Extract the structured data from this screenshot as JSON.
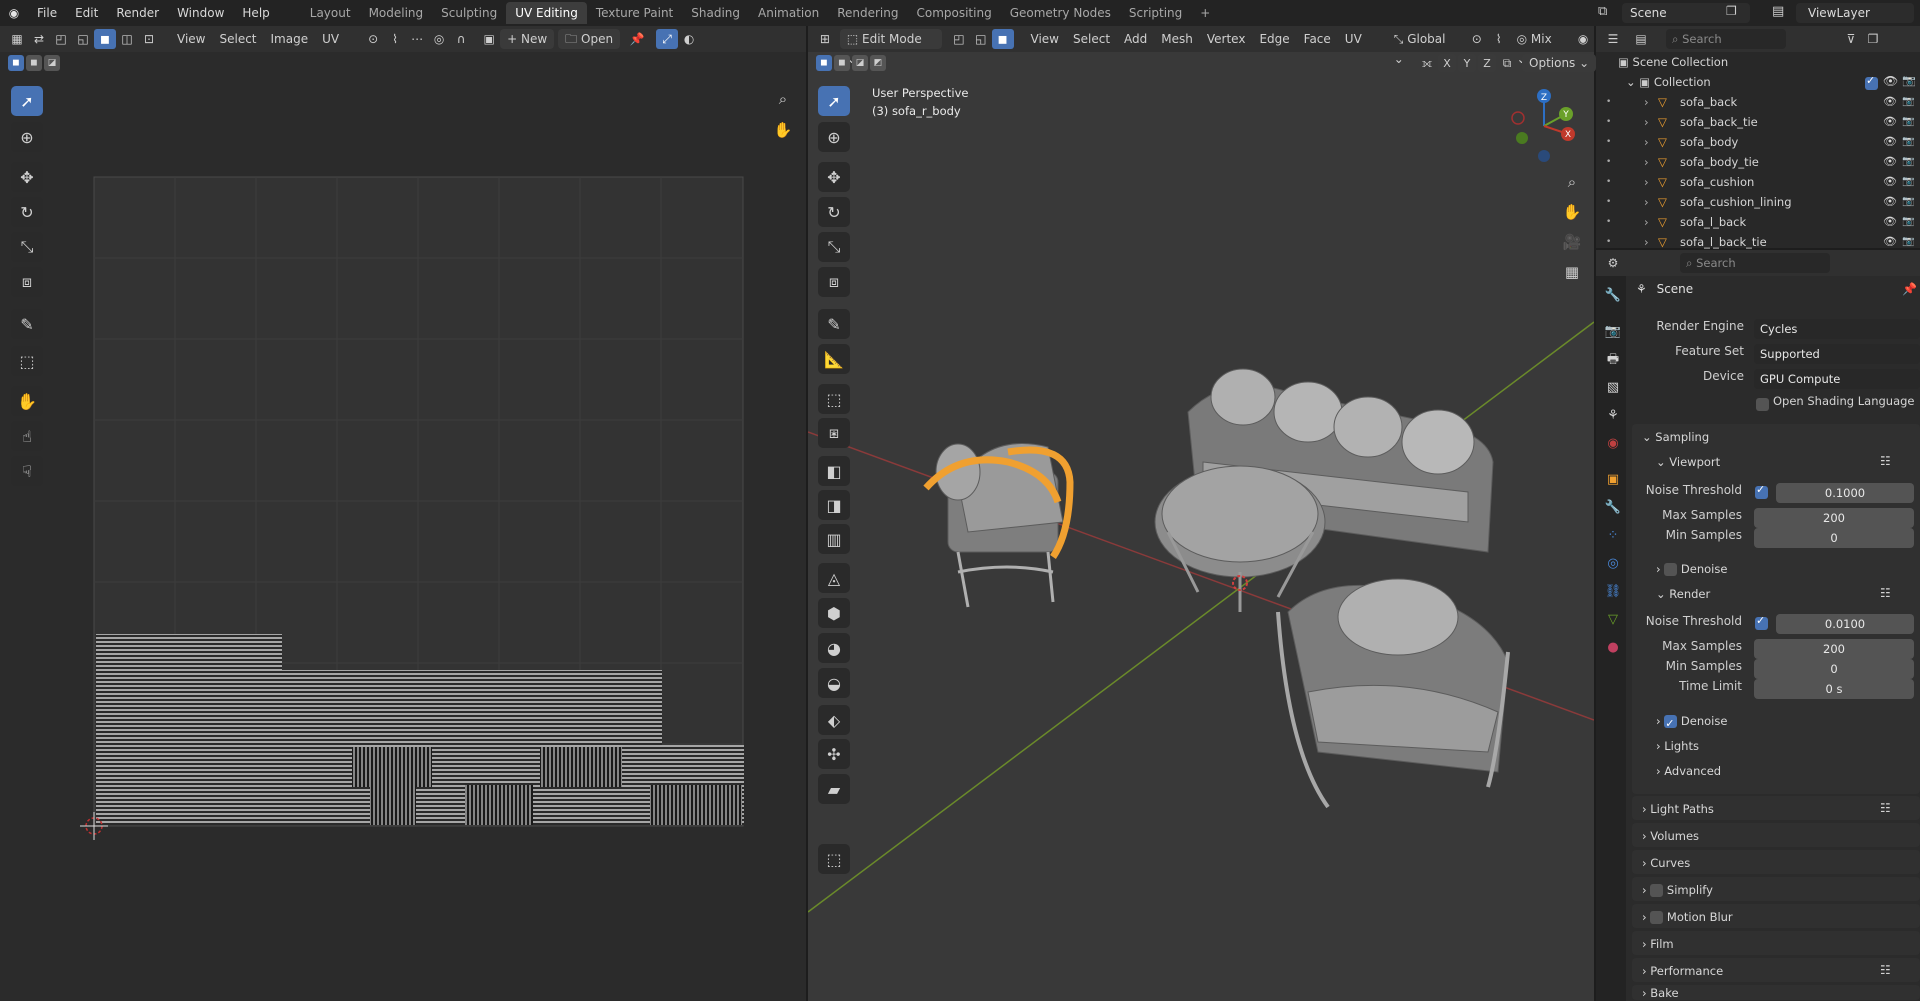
{
  "topbar": {
    "menus": [
      "File",
      "Edit",
      "Render",
      "Window",
      "Help"
    ],
    "workspaces": [
      "Layout",
      "Modeling",
      "Sculpting",
      "UV Editing",
      "Texture Paint",
      "Shading",
      "Animation",
      "Rendering",
      "Compositing",
      "Geometry Nodes",
      "Scripting"
    ],
    "active_workspace": "UV Editing",
    "scene_name": "Scene",
    "view_layer": "ViewLayer",
    "add_tab": "+"
  },
  "uv_editor": {
    "menus": [
      "View",
      "Select",
      "Image",
      "UV"
    ],
    "new_label": "New",
    "open_label": "Open"
  },
  "viewport": {
    "mode": "Edit Mode",
    "menus": [
      "View",
      "Select",
      "Add",
      "Mesh",
      "Vertex",
      "Edge",
      "Face",
      "UV"
    ],
    "orientation": "Global",
    "proportional": "Mix",
    "axes": [
      "X",
      "Y",
      "Z"
    ],
    "options_label": "Options",
    "overlay_line1": "User Perspective",
    "overlay_line2": "(3) sofa_r_body",
    "gizmo": {
      "x": "X",
      "y": "Y",
      "z": "Z"
    }
  },
  "outliner": {
    "search_placeholder": "Search",
    "root": "Scene Collection",
    "collection": "Collection",
    "items": [
      "sofa_back",
      "sofa_back_tie",
      "sofa_body",
      "sofa_body_tie",
      "sofa_cushion",
      "sofa_cushion_lining",
      "sofa_l_back",
      "sofa_l_back_tie"
    ]
  },
  "properties": {
    "search_placeholder": "Search",
    "context": "Scene",
    "render_engine_label": "Render Engine",
    "render_engine": "Cycles",
    "feature_set_label": "Feature Set",
    "feature_set": "Supported",
    "device_label": "Device",
    "device": "GPU Compute",
    "osl_label": "Open Shading Language",
    "sampling": "Sampling",
    "viewport": "Viewport",
    "noise_threshold_label": "Noise Threshold",
    "viewport_noise": "0.1000",
    "max_samples_label": "Max Samples",
    "viewport_max": "200",
    "min_samples_label": "Min Samples",
    "viewport_min": "0",
    "denoise_label": "Denoise",
    "render": "Render",
    "render_noise": "0.0100",
    "render_max": "200",
    "render_min": "0",
    "time_limit_label": "Time Limit",
    "time_limit": "0 s",
    "lights": "Lights",
    "advanced": "Advanced",
    "light_paths": "Light Paths",
    "volumes": "Volumes",
    "curves": "Curves",
    "simplify": "Simplify",
    "motion_blur": "Motion Blur",
    "film": "Film",
    "performance": "Performance",
    "bake": "Bake"
  },
  "colors": {
    "accent": "#4772b3",
    "selection": "#f0a030",
    "x_axis": "#c0392b",
    "y_axis": "#6aa02a",
    "z_axis": "#2d6fc4"
  }
}
